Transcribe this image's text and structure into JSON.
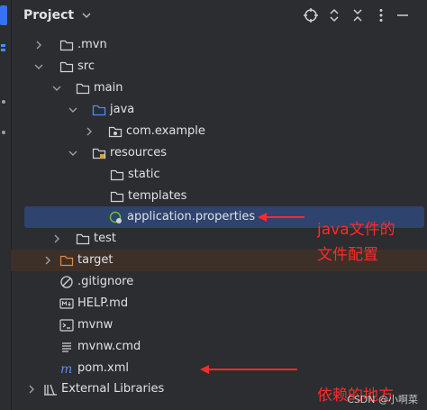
{
  "header": {
    "title": "Project"
  },
  "tree": [
    {
      "label": "mvn"
    },
    {
      "label": "src"
    },
    {
      "label": "main"
    },
    {
      "label": "java"
    },
    {
      "label": "com.example"
    },
    {
      "label": "resources"
    },
    {
      "label": "static"
    },
    {
      "label": "templates"
    },
    {
      "label": "application.properties"
    },
    {
      "label": "test"
    },
    {
      "label": "target"
    },
    {
      "label": ".gitignore"
    },
    {
      "label": "HELP.md"
    },
    {
      "label": "mvnw"
    },
    {
      "label": "mvnw.cmd"
    },
    {
      "label": "pom.xml"
    },
    {
      "label": "External Libraries"
    }
  ],
  "annotations": {
    "properties_line1": "java文件的",
    "properties_line2": "文件配置",
    "pom": "依赖的地方"
  },
  "watermark": "CSDN @小啊菜",
  "colors": {
    "accent": "#3574f0",
    "selection": "#2e436e",
    "excluded": "#3d3028",
    "annotation": "#ff2a2a"
  }
}
